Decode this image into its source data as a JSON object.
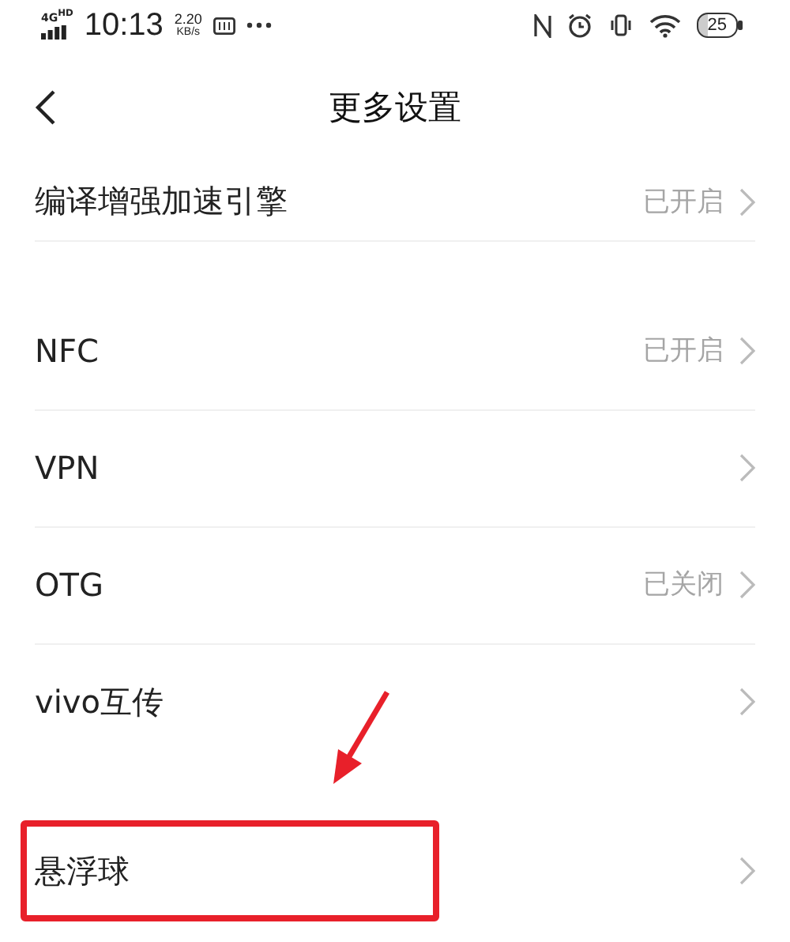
{
  "status_bar": {
    "network": "4G",
    "network_badge": "HD",
    "time": "10:13",
    "speed": "2.20",
    "speed_unit": "KB/s",
    "battery": "25"
  },
  "header": {
    "title": "更多设置"
  },
  "sections": [
    {
      "items": [
        {
          "label": "编译增强加速引擎",
          "value": "已开启",
          "highlighted": false
        }
      ]
    },
    {
      "items": [
        {
          "label": "NFC",
          "value": "已开启",
          "highlighted": false
        },
        {
          "label": "VPN",
          "highlighted": false
        },
        {
          "label": "OTG",
          "value": "已关闭",
          "highlighted": false
        },
        {
          "label": "vivo互传",
          "highlighted": false
        }
      ]
    },
    {
      "items": [
        {
          "label": "悬浮球",
          "highlighted": true
        }
      ]
    }
  ]
}
